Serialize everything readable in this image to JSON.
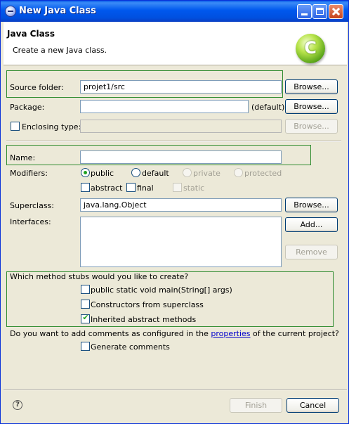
{
  "window": {
    "title": "New Java Class"
  },
  "banner": {
    "title": "Java Class",
    "description": "Create a new Java class.",
    "logo_letter": "C"
  },
  "source_folder": {
    "label": "Source folder:",
    "value": "projet1/src",
    "browse": "Browse..."
  },
  "package": {
    "label": "Package:",
    "value": "",
    "default_hint": "(default)",
    "browse": "Browse..."
  },
  "enclosing_type": {
    "label": "Enclosing type:",
    "checked": false,
    "value": "",
    "browse": "Browse..."
  },
  "name": {
    "label": "Name:",
    "value": ""
  },
  "modifiers": {
    "label": "Modifiers:",
    "access": [
      {
        "label": "public",
        "selected": true,
        "enabled": true
      },
      {
        "label": "default",
        "selected": false,
        "enabled": true
      },
      {
        "label": "private",
        "selected": false,
        "enabled": false
      },
      {
        "label": "protected",
        "selected": false,
        "enabled": false
      }
    ],
    "other": [
      {
        "label": "abstract",
        "checked": false,
        "enabled": true
      },
      {
        "label": "final",
        "checked": false,
        "enabled": true
      },
      {
        "label": "static",
        "checked": false,
        "enabled": false
      }
    ]
  },
  "superclass": {
    "label": "Superclass:",
    "value": "java.lang.Object",
    "browse": "Browse..."
  },
  "interfaces": {
    "label": "Interfaces:",
    "add": "Add...",
    "remove": "Remove"
  },
  "stubs": {
    "question": "Which method stubs would you like to create?",
    "options": [
      {
        "label": "public static void main(String[] args)",
        "checked": false
      },
      {
        "label": "Constructors from superclass",
        "checked": false
      },
      {
        "label": "Inherited abstract methods",
        "checked": true
      }
    ]
  },
  "comments": {
    "question_prefix": "Do you want to add comments as configured in the ",
    "link": "properties",
    "question_suffix": " of the current project?",
    "option": "Generate comments",
    "checked": false
  },
  "footer": {
    "help": "?",
    "finish": "Finish",
    "cancel": "Cancel"
  },
  "colors": {
    "titlebar": "#0058ee",
    "highlight_border": "#2e8b2e",
    "dialog_bg": "#ece9d8",
    "link": "#0000cc"
  }
}
